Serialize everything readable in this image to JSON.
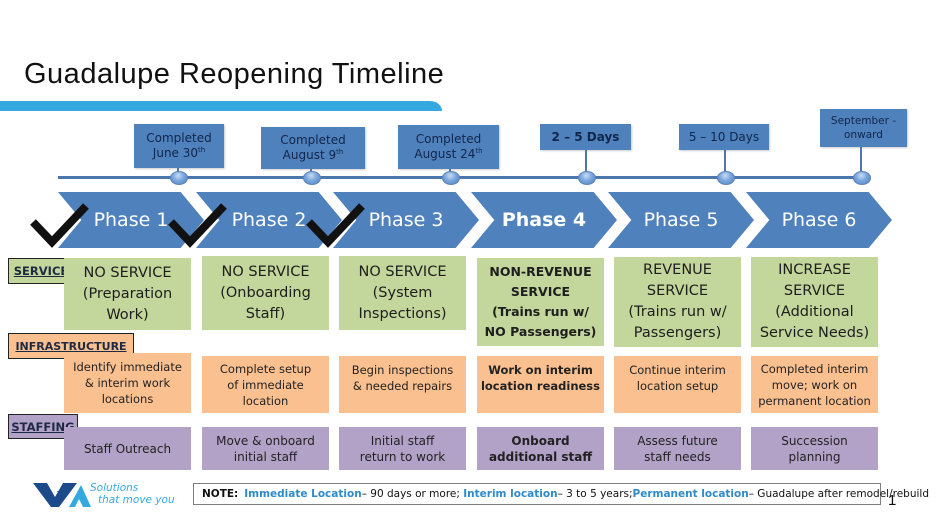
{
  "title": "Guadalupe Reopening Timeline",
  "milestones": [
    {
      "line1": "Completed",
      "line2": "June 30",
      "sup": "th",
      "bold": false
    },
    {
      "line1": "Completed",
      "line2": "August 9",
      "sup": "th",
      "bold": false
    },
    {
      "line1": "Completed",
      "line2": "August 24",
      "sup": "th",
      "bold": false
    },
    {
      "line1": "2 – 5 Days",
      "line2": "",
      "sup": "",
      "bold": true
    },
    {
      "line1": "5 – 10 Days",
      "line2": "",
      "sup": "",
      "bold": false
    },
    {
      "line1": "September -",
      "line2": "onward",
      "sup": "",
      "bold": false
    }
  ],
  "phases": [
    {
      "label": "Phase 1",
      "completed": true,
      "current": false
    },
    {
      "label": "Phase 2",
      "completed": true,
      "current": false
    },
    {
      "label": "Phase 3",
      "completed": true,
      "current": false
    },
    {
      "label": "Phase 4",
      "completed": false,
      "current": true
    },
    {
      "label": "Phase 5",
      "completed": false,
      "current": false
    },
    {
      "label": "Phase 6",
      "completed": false,
      "current": false
    }
  ],
  "row_labels": {
    "service": "SERVICE",
    "infrastructure": "INFRASTRUCTURE",
    "staffing": "STAFFING"
  },
  "service": [
    [
      "NO SERVICE",
      "(Preparation",
      "Work)"
    ],
    [
      "NO SERVICE",
      "(Onboarding",
      "Staff)"
    ],
    [
      "NO SERVICE",
      "(System",
      "Inspections)"
    ],
    [
      "NON-REVENUE",
      "SERVICE",
      "(Trains run w/",
      "NO Passengers)"
    ],
    [
      "REVENUE",
      "SERVICE",
      "(Trains run w/",
      "Passengers)"
    ],
    [
      "INCREASE",
      "SERVICE",
      "(Additional",
      "Service Needs)"
    ]
  ],
  "infrastructure": [
    [
      "Identify immediate",
      "& interim work",
      "locations"
    ],
    [
      "Complete setup",
      "of immediate",
      "location"
    ],
    [
      "Begin inspections",
      "& needed repairs"
    ],
    [
      "Work on interim",
      "location readiness"
    ],
    [
      "Continue interim",
      "location setup"
    ],
    [
      "Completed interim",
      "move; work on",
      "permanent location"
    ]
  ],
  "staffing": [
    [
      "Staff Outreach"
    ],
    [
      "Move & onboard",
      "initial staff"
    ],
    [
      "Initial staff",
      "return to work"
    ],
    [
      "Onboard",
      "additional staff"
    ],
    [
      "Assess future",
      "staff needs"
    ],
    [
      "Succession",
      "planning"
    ]
  ],
  "note": {
    "lead": "NOTE:",
    "immediate_label": "Immediate Location",
    "immediate_text": " – 90 days or more;  ",
    "interim_label": "Interim location",
    "interim_text": " – 3 to 5 years; ",
    "permanent_label": "Permanent location",
    "permanent_text": " – Guadalupe after remodel/rebuild"
  },
  "logo": {
    "tagline_line1": "Solutions",
    "tagline_line2": "that move you"
  },
  "page_number": "1",
  "colors": {
    "accent_blue": "#4f81bd",
    "title_bar": "#35a9df",
    "service_green": "#c3d69b",
    "infrastructure_orange": "#fac090",
    "staffing_purple": "#b3a2c7",
    "note_highlight": "#2e8ac8"
  }
}
